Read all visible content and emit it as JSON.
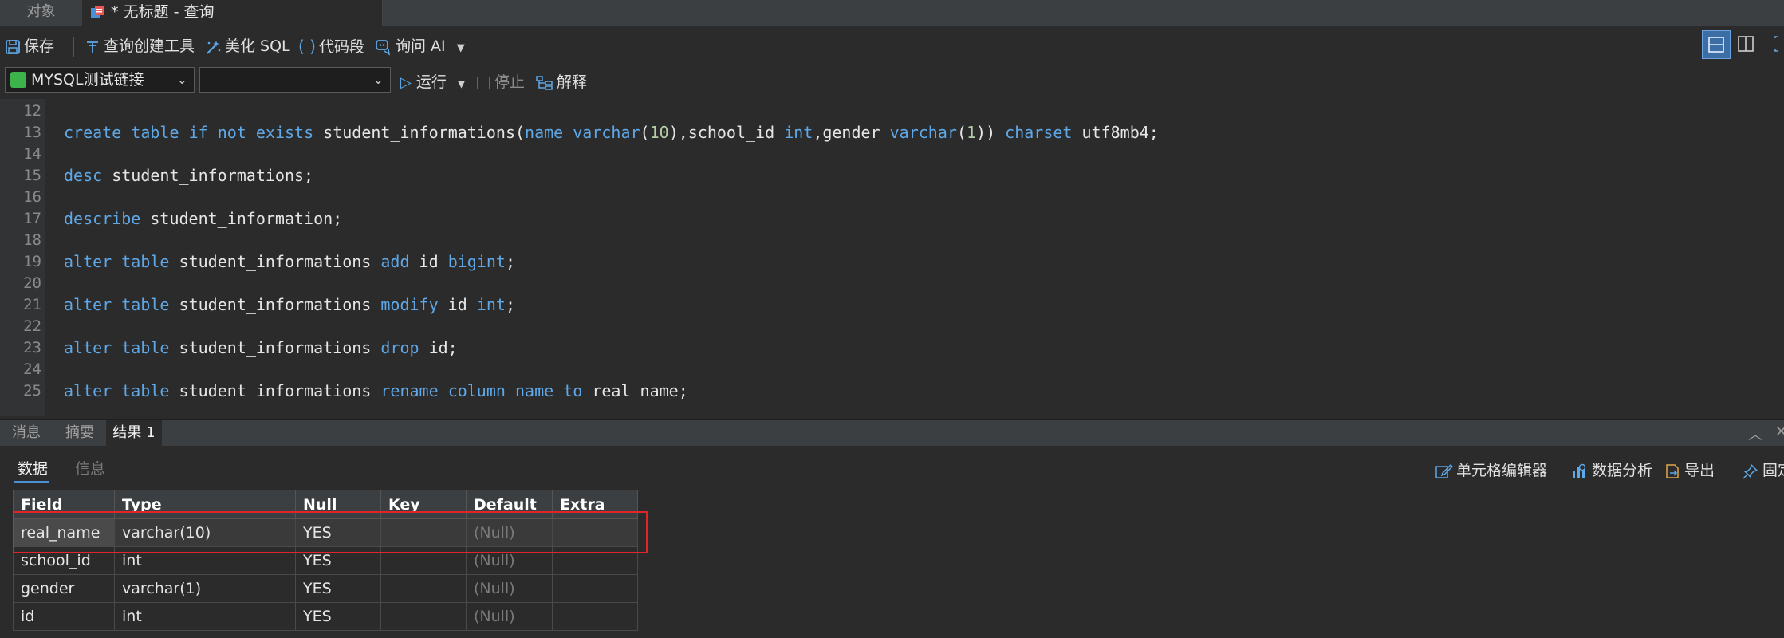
{
  "tabs": {
    "objects_label": "对象",
    "query_tab_label": "* 无标题 - 查询"
  },
  "toolbar": {
    "save_label": "保存",
    "query_builder_label": "查询创建工具",
    "beautify_label": "美化 SQL",
    "snippet_label": "代码段",
    "ask_ai_label": "询问 AI"
  },
  "connection": {
    "selected": "MYSQL测试链接",
    "database_selected": "",
    "run_label": "运行",
    "stop_label": "停止",
    "explain_label": "解释"
  },
  "editor": {
    "line_numbers": [
      "12",
      "13",
      "14",
      "15",
      "16",
      "17",
      "18",
      "19",
      "20",
      "21",
      "22",
      "23",
      "24",
      "25"
    ]
  },
  "bottom_tabs": {
    "messages_label": "消息",
    "summary_label": "摘要",
    "result_label": "结果 1"
  },
  "result_subtabs": {
    "data_label": "数据",
    "info_label": "信息"
  },
  "result_tools": {
    "cell_editor_label": "单元格编辑器",
    "data_analysis_label": "数据分析",
    "export_label": "导出",
    "pin_label": "固定"
  },
  "grid": {
    "columns": [
      "Field",
      "Type",
      "Null",
      "Key",
      "Default",
      "Extra"
    ],
    "rows": [
      [
        "real_name",
        "varchar(10)",
        "YES",
        "",
        "(Null)",
        ""
      ],
      [
        "school_id",
        "int",
        "YES",
        "",
        "(Null)",
        ""
      ],
      [
        "gender",
        "varchar(1)",
        "YES",
        "",
        "(Null)",
        ""
      ],
      [
        "id",
        "int",
        "YES",
        "",
        "(Null)",
        ""
      ]
    ]
  },
  "colors": {
    "keyword": "#5fa8e8",
    "number": "#b5cea8",
    "accent": "#4a90d9",
    "highlight": "#e0242a"
  }
}
